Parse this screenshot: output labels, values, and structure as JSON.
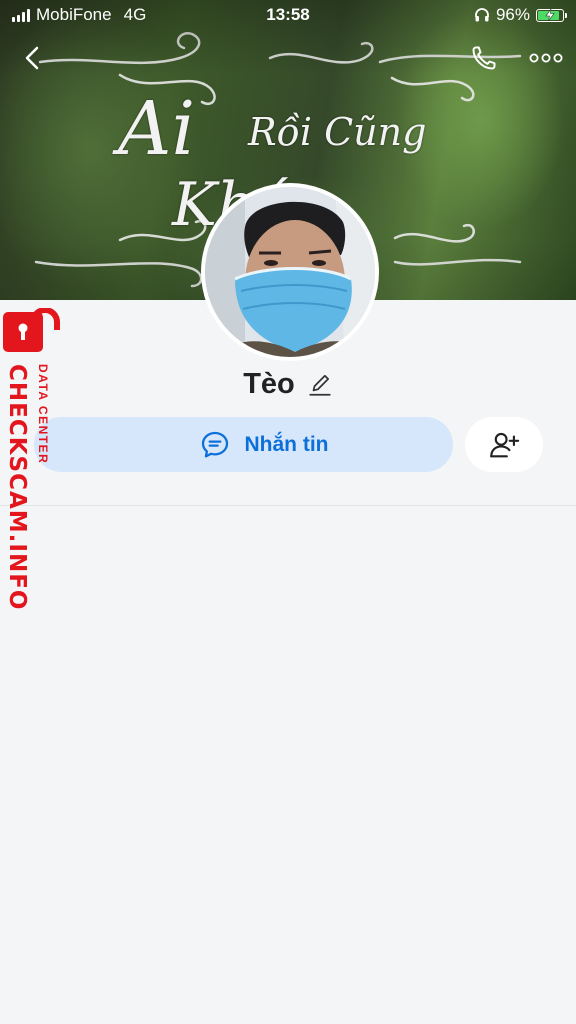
{
  "status_bar": {
    "carrier": "MobiFone",
    "network": "4G",
    "time": "13:58",
    "battery_percent": "96%",
    "battery_level": 0.96,
    "battery_color": "#4cd964"
  },
  "nav": {
    "back_icon": "chevron-left-icon",
    "call_icon": "phone-icon",
    "more_icon": "more-dots-icon"
  },
  "cover": {
    "script_line1": "Ai",
    "script_line2": "Rồi Cũng",
    "script_line3": "Khác"
  },
  "profile": {
    "name": "Tèo",
    "edit_icon": "pencil-icon"
  },
  "actions": {
    "message_label": "Nhắn tin",
    "message_icon": "chat-bubble-icon",
    "add_friend_icon": "add-user-icon",
    "accent_color": "#0d6fd9"
  },
  "watermark": {
    "main": "CHECKSCAM.INFO",
    "sub": "DATA CENTER",
    "color": "#e3161e"
  }
}
